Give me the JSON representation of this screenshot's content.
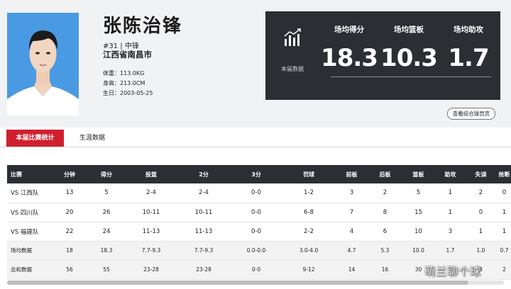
{
  "player": {
    "name": "张陈治锋",
    "number_position": "#31 | 中锋",
    "hometown": "江西省南昌市",
    "weight": "体重：113.0KG",
    "height": "身高：213.0CM",
    "birthday": "生日：2003-05-25"
  },
  "season_stats": {
    "label": "本届数据",
    "items": [
      {
        "label": "场均得分",
        "value": "18.3"
      },
      {
        "label": "场均篮板",
        "value": "10.3"
      },
      {
        "label": "场均助攻",
        "value": "1.7"
      }
    ]
  },
  "more_button": "查看综合球员页",
  "tabs": [
    {
      "label": "本届比赛统计",
      "active": true
    },
    {
      "label": "生涯数据",
      "active": false
    }
  ],
  "table": {
    "headers": [
      "比赛",
      "分钟",
      "得分",
      "投篮",
      "2分",
      "3分",
      "罚球",
      "前板",
      "后板",
      "篮板",
      "助攻",
      "失误",
      "抢断"
    ],
    "rows": [
      [
        "VS 江西队",
        "13",
        "5",
        "2-4",
        "2-4",
        "0-0",
        "1-2",
        "3",
        "2",
        "5",
        "1",
        "2",
        "0"
      ],
      [
        "VS 四川队",
        "20",
        "26",
        "10-11",
        "10-11",
        "0-0",
        "6-8",
        "7",
        "8",
        "15",
        "1",
        "0",
        "1"
      ],
      [
        "VS 福建队",
        "22",
        "24",
        "11-13",
        "11-13",
        "0-0",
        "2-2",
        "4",
        "6",
        "10",
        "3",
        "1",
        "1"
      ],
      [
        "场均数据",
        "18",
        "18.3",
        "7.7-9.3",
        "7.7-9.3",
        "0.0-0.0",
        "3.0-4.0",
        "4.7",
        "5.3",
        "10.0",
        "1.7",
        "1.0",
        "0.7"
      ],
      [
        "总和数据",
        "56",
        "55",
        "23-28",
        "23-28",
        "0-0",
        "9-12",
        "14",
        "16",
        "30",
        "5",
        "3",
        "2"
      ]
    ]
  },
  "watermark": "萌兰聊个球",
  "colors": {
    "accent_red": "#cf1f2e",
    "dark_panel": "#2b2e33",
    "photo_bg": "#4a9ae3"
  }
}
